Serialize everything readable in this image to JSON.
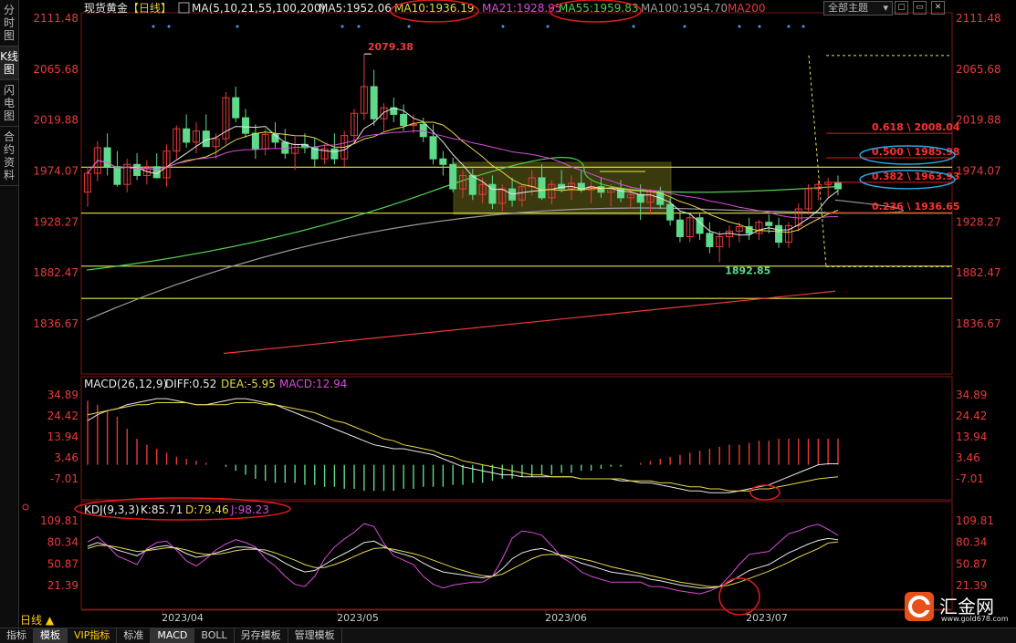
{
  "sidebar": {
    "tabs": [
      {
        "label": "分时图",
        "active": false
      },
      {
        "label": "K线图",
        "active": true
      },
      {
        "label": "闪电图",
        "active": false
      },
      {
        "label": "合约资料",
        "active": false
      }
    ]
  },
  "header": {
    "symbol": "现货黄金",
    "period_tag": "【日线】",
    "ma_label": "MA(5,10,21,55,100,200)",
    "ma_values": [
      {
        "text": "MA5:1952.06",
        "color": "#e8e8e8"
      },
      {
        "text": "MA10:1936.19",
        "color": "#e8d84a"
      },
      {
        "text": "MA21:1928.95",
        "color": "#d94dd9"
      },
      {
        "text": "MA55:1959.83",
        "color": "#4fd24f"
      },
      {
        "text": "MA100:1954.70",
        "color": "#9a9a9a"
      },
      {
        "text": "MA200",
        "color": "#e83a3a"
      }
    ],
    "theme_button": "全部主题",
    "window_buttons": [
      "▢",
      "▭",
      "✕"
    ]
  },
  "macd_header": {
    "title": "MACD(26,12,9)",
    "diff": "DIFF:0.52",
    "dea": "DEA:-5.95",
    "macd": "MACD:12.94"
  },
  "kdj_header": {
    "title": "KDJ(9,3,3)",
    "k": "K:85.71",
    "d": "D:79.46",
    "j": "J:98.23"
  },
  "bottom_tabs": [
    {
      "label": "指标",
      "active": false
    },
    {
      "label": "模板",
      "active": true
    },
    {
      "label": "VIP指标",
      "active": false
    },
    {
      "label": "标准",
      "active": false
    },
    {
      "label": "MACD",
      "active": true
    },
    {
      "label": "BOLL",
      "active": false
    },
    {
      "label": "另存模板",
      "active": false
    },
    {
      "label": "管理模板",
      "active": false
    }
  ],
  "period_label": "日线 ▲",
  "logo": {
    "name": "汇金网",
    "url": "www.gold678.com"
  },
  "colors": {
    "bull": "#e83a3a",
    "bear": "#5fd98a",
    "yellow_line": "#e6e64a",
    "box": "#6b6b1a",
    "annot_red": "#e01a1a",
    "annot_blue": "#2aa7e0"
  },
  "chart_data": [
    {
      "type": "candlestick",
      "title": "现货黄金 日线",
      "x_ticks": [
        "2023/04",
        "2023/05",
        "2023/06",
        "2023/07"
      ],
      "y_ticks": [
        2111.48,
        2065.68,
        2019.88,
        1974.07,
        1928.27,
        1882.47,
        1836.67
      ],
      "ylim": [
        1800,
        2115
      ],
      "annotations": [
        {
          "text": "2079.38",
          "value": 2079.38,
          "kind": "high"
        },
        {
          "text": "1892.85",
          "value": 1892.85,
          "kind": "low"
        }
      ],
      "fibonacci": [
        {
          "label": "0.618 \\ 2008.04",
          "value": 2008.04
        },
        {
          "label": "0.500 \\ 1985.98",
          "value": 1985.98
        },
        {
          "label": "0.382 \\ 1963.93",
          "value": 1963.93
        },
        {
          "label": "0.236 \\ 1936.65",
          "value": 1936.65
        }
      ],
      "horizontal_lines": [
        1977.5,
        1936.2,
        1888.5,
        1859.5
      ],
      "candles": [
        [
          1955,
          1978,
          1942,
          1972
        ],
        [
          1972,
          2001,
          1965,
          1995
        ],
        [
          1995,
          2008,
          1970,
          1978
        ],
        [
          1978,
          1992,
          1960,
          1962
        ],
        [
          1962,
          1985,
          1955,
          1980
        ],
        [
          1980,
          1990,
          1966,
          1970
        ],
        [
          1970,
          1984,
          1962,
          1978
        ],
        [
          1978,
          1990,
          1970,
          1968
        ],
        [
          1968,
          1998,
          1960,
          1992
        ],
        [
          1992,
          2015,
          1985,
          2012
        ],
        [
          2012,
          2025,
          1995,
          2000
        ],
        [
          2000,
          2018,
          1990,
          2010
        ],
        [
          2010,
          2025,
          2000,
          1996
        ],
        [
          1996,
          2008,
          1985,
          2003
        ],
        [
          2003,
          2045,
          1998,
          2040
        ],
        [
          2040,
          2050,
          2018,
          2022
        ],
        [
          2022,
          2030,
          2004,
          2008
        ],
        [
          2008,
          2016,
          1985,
          1994
        ],
        [
          1994,
          2012,
          1988,
          2007
        ],
        [
          2007,
          2018,
          1995,
          2000
        ],
        [
          2000,
          2012,
          1985,
          1990
        ],
        [
          1990,
          2005,
          1975,
          1998
        ],
        [
          1998,
          2008,
          1990,
          1995
        ],
        [
          1995,
          2004,
          1978,
          1985
        ],
        [
          1985,
          1998,
          1980,
          1994
        ],
        [
          1994,
          2008,
          1980,
          1985
        ],
        [
          1985,
          2010,
          1978,
          2006
        ],
        [
          2006,
          2030,
          2000,
          2026
        ],
        [
          2026,
          2079,
          2020,
          2050
        ],
        [
          2050,
          2065,
          2015,
          2021
        ],
        [
          2021,
          2035,
          2010,
          2031
        ],
        [
          2031,
          2040,
          2018,
          2025
        ],
        [
          2025,
          2034,
          2010,
          2015
        ],
        [
          2015,
          2025,
          2008,
          2016
        ],
        [
          2016,
          2022,
          2000,
          2005
        ],
        [
          2005,
          2016,
          1980,
          1985
        ],
        [
          1985,
          1992,
          1970,
          1980
        ],
        [
          1980,
          1986,
          1955,
          1958
        ],
        [
          1958,
          1975,
          1950,
          1970
        ],
        [
          1970,
          1976,
          1948,
          1953
        ],
        [
          1953,
          1968,
          1945,
          1962
        ],
        [
          1962,
          1970,
          1940,
          1945
        ],
        [
          1945,
          1962,
          1938,
          1958
        ],
        [
          1958,
          1968,
          1942,
          1948
        ],
        [
          1948,
          1962,
          1942,
          1960
        ],
        [
          1960,
          1975,
          1952,
          1968
        ],
        [
          1968,
          1980,
          1948,
          1950
        ],
        [
          1950,
          1966,
          1944,
          1962
        ],
        [
          1962,
          1975,
          1955,
          1958
        ],
        [
          1958,
          1970,
          1948,
          1963
        ],
        [
          1963,
          1975,
          1955,
          1957
        ],
        [
          1957,
          1965,
          1945,
          1960
        ],
        [
          1960,
          1968,
          1950,
          1955
        ],
        [
          1955,
          1962,
          1942,
          1958
        ],
        [
          1958,
          1966,
          1946,
          1950
        ],
        [
          1950,
          1960,
          1940,
          1953
        ],
        [
          1953,
          1962,
          1930,
          1946
        ],
        [
          1946,
          1958,
          1935,
          1956
        ],
        [
          1956,
          1960,
          1940,
          1944
        ],
        [
          1944,
          1950,
          1925,
          1930
        ],
        [
          1930,
          1938,
          1910,
          1915
        ],
        [
          1915,
          1935,
          1910,
          1932
        ],
        [
          1932,
          1936,
          1912,
          1918
        ],
        [
          1918,
          1928,
          1900,
          1906
        ],
        [
          1906,
          1920,
          1892,
          1915
        ],
        [
          1915,
          1925,
          1905,
          1920
        ],
        [
          1920,
          1928,
          1910,
          1924
        ],
        [
          1924,
          1932,
          1912,
          1918
        ],
        [
          1918,
          1930,
          1912,
          1928
        ],
        [
          1928,
          1935,
          1918,
          1925
        ],
        [
          1925,
          1932,
          1905,
          1910
        ],
        [
          1910,
          1928,
          1905,
          1925
        ],
        [
          1925,
          1945,
          1920,
          1940
        ],
        [
          1940,
          1962,
          1935,
          1958
        ],
        [
          1958,
          1966,
          1948,
          1962
        ],
        [
          1962,
          1968,
          1950,
          1964
        ],
        [
          1964,
          1970,
          1952,
          1958
        ]
      ]
    },
    {
      "type": "bar+line",
      "title": "MACD(26,12,9)",
      "y_ticks": [
        34.89,
        24.42,
        13.94,
        3.46,
        -7.01
      ],
      "ylim": [
        -12,
        38
      ],
      "histogram": [
        32,
        30,
        27,
        24,
        18,
        13,
        10,
        8,
        6,
        4,
        3,
        2,
        1,
        0,
        -1,
        -3,
        -5,
        -7,
        -8,
        -9,
        -9,
        -9,
        -10,
        -10,
        -11,
        -11,
        -12,
        -12,
        -13,
        -13,
        -13,
        -13,
        -12,
        -12,
        -11,
        -11,
        -11,
        -10,
        -10,
        -9,
        -9,
        -8,
        -7,
        -7,
        -6,
        -6,
        -5,
        -5,
        -4,
        -4,
        -3,
        -3,
        -2,
        -1,
        -1,
        0,
        1,
        2,
        3,
        4,
        5,
        6,
        7,
        8,
        9,
        10,
        10,
        11,
        12,
        12,
        13,
        13,
        13,
        13,
        13,
        13,
        13
      ],
      "diff": [
        22,
        25,
        27,
        28,
        30,
        31,
        32,
        33,
        33,
        32,
        31,
        30,
        30,
        31,
        32,
        33,
        33,
        32,
        31,
        30,
        28,
        26,
        24,
        22,
        20,
        18,
        16,
        14,
        12,
        10,
        9,
        8,
        8,
        7,
        6,
        5,
        3,
        1,
        -1,
        -2,
        -3,
        -4,
        -5,
        -5,
        -6,
        -6,
        -6,
        -6,
        -6,
        -6,
        -7,
        -7,
        -7,
        -7,
        -8,
        -8,
        -9,
        -9,
        -10,
        -11,
        -12,
        -13,
        -13,
        -14,
        -14,
        -14,
        -13,
        -12,
        -11,
        -10,
        -8,
        -6,
        -4,
        -2,
        0,
        0.5,
        0.52
      ],
      "dea": [
        25,
        26,
        27,
        28,
        29,
        30,
        30,
        31,
        31,
        31,
        31,
        30,
        30,
        30,
        30,
        31,
        31,
        31,
        30,
        30,
        29,
        28,
        27,
        26,
        24,
        22,
        21,
        19,
        17,
        15,
        13,
        12,
        10,
        9,
        8,
        7,
        5,
        4,
        2,
        1,
        0,
        -1,
        -2,
        -3,
        -4,
        -5,
        -5,
        -6,
        -6,
        -6,
        -7,
        -7,
        -7,
        -7,
        -7,
        -8,
        -8,
        -8,
        -9,
        -9,
        -10,
        -11,
        -11,
        -12,
        -12,
        -13,
        -13,
        -13,
        -12,
        -12,
        -11,
        -10,
        -9,
        -8,
        -7,
        -6.5,
        -5.95
      ]
    },
    {
      "type": "line",
      "title": "KDJ(9,3,3)",
      "y_ticks": [
        109.81,
        80.34,
        50.87,
        21.39
      ],
      "ylim": [
        0,
        118
      ],
      "k": [
        75,
        80,
        76,
        70,
        66,
        62,
        70,
        74,
        76,
        72,
        65,
        60,
        62,
        66,
        70,
        74,
        74,
        72,
        66,
        60,
        52,
        45,
        40,
        42,
        50,
        58,
        65,
        72,
        80,
        82,
        75,
        68,
        64,
        60,
        52,
        45,
        40,
        38,
        36,
        34,
        32,
        34,
        44,
        58,
        66,
        70,
        72,
        68,
        62,
        58,
        52,
        48,
        44,
        40,
        38,
        36,
        34,
        30,
        28,
        25,
        22,
        20,
        18,
        18,
        20,
        26,
        34,
        42,
        46,
        50,
        58,
        66,
        72,
        78,
        83,
        85.71,
        84
      ],
      "d": [
        72,
        76,
        76,
        74,
        71,
        68,
        69,
        71,
        73,
        73,
        70,
        66,
        64,
        64,
        66,
        69,
        71,
        71,
        70,
        66,
        61,
        56,
        50,
        46,
        46,
        50,
        55,
        61,
        67,
        72,
        73,
        71,
        68,
        65,
        61,
        56,
        51,
        46,
        42,
        38,
        35,
        34,
        37,
        44,
        51,
        58,
        63,
        64,
        63,
        61,
        58,
        55,
        51,
        47,
        44,
        41,
        38,
        35,
        32,
        29,
        26,
        24,
        22,
        20,
        20,
        22,
        26,
        31,
        36,
        41,
        47,
        53,
        60,
        66,
        72,
        79.46,
        81
      ],
      "j": [
        81,
        88,
        76,
        62,
        56,
        50,
        72,
        80,
        82,
        70,
        55,
        48,
        58,
        70,
        78,
        84,
        80,
        74,
        58,
        48,
        34,
        23,
        20,
        34,
        58,
        74,
        85,
        94,
        106,
        102,
        79,
        62,
        56,
        50,
        34,
        23,
        18,
        22,
        24,
        26,
        26,
        34,
        58,
        86,
        96,
        94,
        90,
        76,
        60,
        52,
        40,
        34,
        30,
        26,
        26,
        26,
        26,
        20,
        20,
        17,
        14,
        12,
        10,
        14,
        20,
        34,
        50,
        64,
        66,
        68,
        80,
        92,
        96,
        102,
        105,
        98.23,
        90
      ]
    }
  ]
}
